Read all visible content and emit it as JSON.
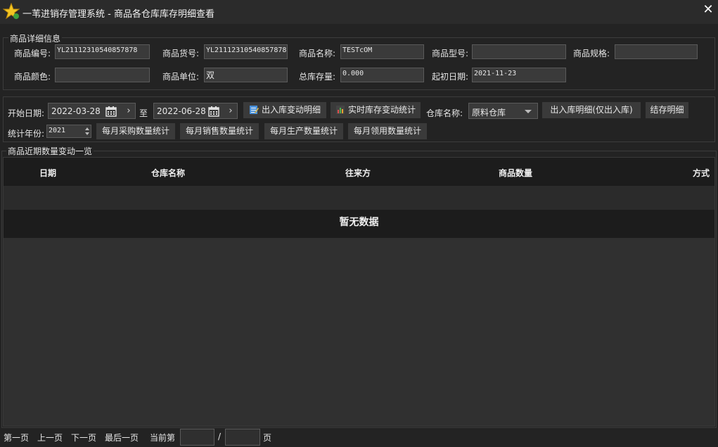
{
  "window": {
    "title": "一苇进销存管理系统 - 商品各仓库库存明细查看",
    "close_glyph": "✕"
  },
  "detail": {
    "legend": "商品详细信息",
    "code_label": "商品编号:",
    "code_value": "YL21112310540857878",
    "sku_label": "商品货号:",
    "sku_value": "YL21112310540857878",
    "name_label": "商品名称:",
    "name_value": "TESTcOM",
    "model_label": "商品型号:",
    "model_value": "",
    "spec_label": "商品规格:",
    "spec_value": "",
    "color_label": "商品颜色:",
    "color_value": "",
    "unit_label": "商品单位:",
    "unit_value": "双",
    "stock_label": "总库存量:",
    "stock_value": "0.000",
    "init_date_label": "起初日期:",
    "init_date_value": "2021-11-23"
  },
  "query": {
    "start_label": "开始日期:",
    "start_date": "2022-03-28",
    "to_label": "至",
    "end_date": "2022-06-28",
    "btn_inout_detail": "出入库变动明细",
    "btn_realtime_stat": "实时库存变动统计",
    "warehouse_label": "仓库名称:",
    "warehouse_value": "原料仓库",
    "btn_inout_only_in": "出入库明细(仅出入库)",
    "btn_balance_detail": "结存明细",
    "year_label": "统计年份:",
    "year_value": "2021",
    "btn_month_purchase": "每月采购数量统计",
    "btn_month_sales": "每月销售数量统计",
    "btn_month_production": "每月生产数量统计",
    "btn_month_requisition": "每月领用数量统计"
  },
  "table": {
    "legend": "商品近期数量变动一览",
    "columns": [
      "日期",
      "仓库名称",
      "往来方",
      "商品数量",
      "方式"
    ],
    "empty_text": "暂无数据"
  },
  "pager": {
    "first": "第一页",
    "prev": "上一页",
    "next": "下一页",
    "last": "最后一页",
    "current_label": "当前第",
    "current_value": "",
    "slash": "/",
    "total_value": "",
    "page_suffix": "页"
  },
  "icons": {
    "app": "star-icon",
    "calendar": "calendar-icon",
    "arrow": "chevron-right-icon",
    "inout": "notepad-icon",
    "realtime": "chart-icon"
  }
}
